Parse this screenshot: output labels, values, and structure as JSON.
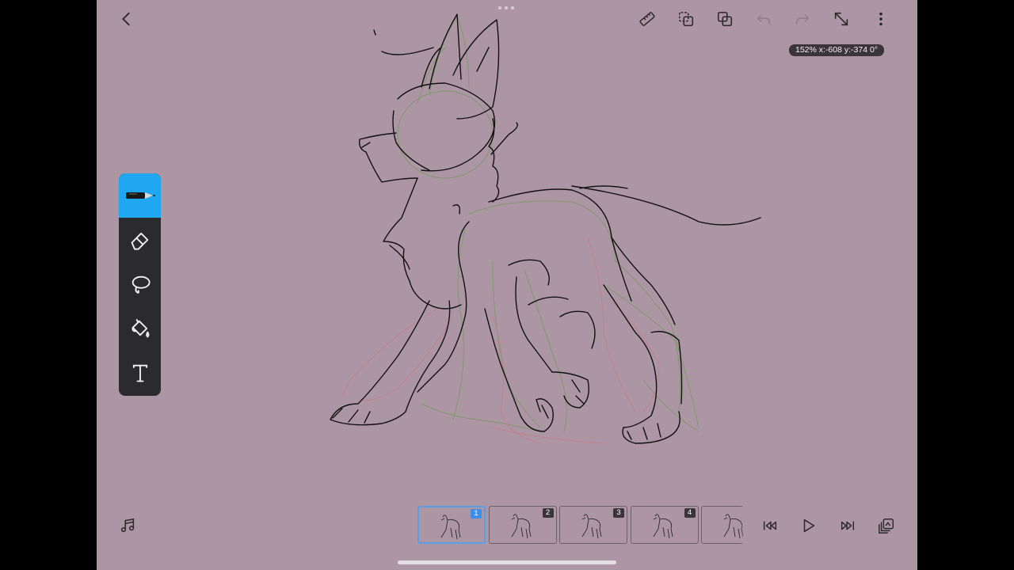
{
  "app": {
    "canvas_color": "#ad96a3",
    "accent_color": "#1fa7f0",
    "status_readout": "152% x:-608 y:-374 0°"
  },
  "top_bar": {
    "buttons": [
      {
        "name": "back",
        "icon": "chevron-left-icon"
      },
      {
        "name": "ruler",
        "icon": "ruler-icon"
      },
      {
        "name": "layers",
        "icon": "layers-icon"
      },
      {
        "name": "duplicate",
        "icon": "duplicate-icon"
      },
      {
        "name": "undo",
        "icon": "undo-icon",
        "enabled": false
      },
      {
        "name": "redo",
        "icon": "redo-icon",
        "enabled": false
      },
      {
        "name": "expand",
        "icon": "expand-arrows-icon"
      },
      {
        "name": "more",
        "icon": "more-vertical-icon"
      }
    ]
  },
  "toolbar": {
    "selected": "pen",
    "tools": [
      {
        "name": "pen",
        "icon": "pen-icon"
      },
      {
        "name": "eraser",
        "icon": "eraser-icon"
      },
      {
        "name": "lasso",
        "icon": "lasso-icon"
      },
      {
        "name": "fill",
        "icon": "paint-bucket-icon"
      },
      {
        "name": "text",
        "icon": "text-icon"
      }
    ]
  },
  "timeline": {
    "frames": [
      {
        "number": "1",
        "active": true
      },
      {
        "number": "2",
        "active": false
      },
      {
        "number": "3",
        "active": false
      },
      {
        "number": "4",
        "active": false
      },
      {
        "number": "",
        "active": false
      }
    ],
    "controls": [
      {
        "name": "audio",
        "icon": "music-note-icon"
      },
      {
        "name": "skip-to-start",
        "icon": "skip-start-icon"
      },
      {
        "name": "play",
        "icon": "play-icon"
      },
      {
        "name": "skip-to-end",
        "icon": "skip-end-icon"
      },
      {
        "name": "onion-skin",
        "icon": "onion-skin-icon"
      }
    ]
  }
}
